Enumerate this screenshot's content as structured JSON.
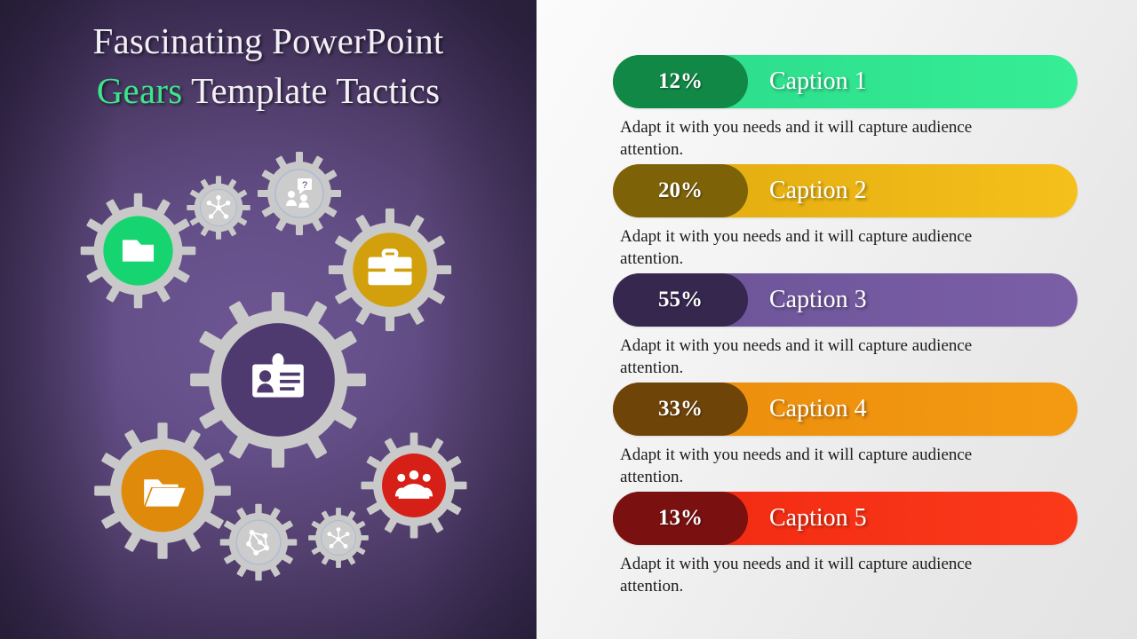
{
  "slide": {
    "title_line1": "Fascinating PowerPoint",
    "title_accent": "Gears",
    "title_line2_rest": " Template Tactics",
    "left_bg_dark": "#2e2442",
    "left_bg_light": "#6d5693",
    "right_bg": "#f2f2f2"
  },
  "gears": [
    {
      "name": "gear-folder-green",
      "icon": "folder-icon",
      "fill": "#16d46f"
    },
    {
      "name": "gear-hub-small",
      "icon": "network-hub-icon",
      "fill": "rgba(255,255,255,0.10)"
    },
    {
      "name": "gear-question-small",
      "icon": "question-people-icon",
      "fill": "rgba(255,255,255,0.10)"
    },
    {
      "name": "gear-briefcase-gold",
      "icon": "briefcase-icon",
      "fill": "#d2a00c"
    },
    {
      "name": "gear-idcard-center",
      "icon": "id-card-icon",
      "fill": "#4e3a6e"
    },
    {
      "name": "gear-openfolder-orange",
      "icon": "open-folder-icon",
      "fill": "#e08a0b"
    },
    {
      "name": "gear-users-red",
      "icon": "users-group-icon",
      "fill": "#d62017"
    },
    {
      "name": "gear-molecule-small",
      "icon": "molecule-icon",
      "fill": "rgba(255,255,255,0.10)"
    },
    {
      "name": "gear-node-small",
      "icon": "node-link-icon",
      "fill": "rgba(255,255,255,0.10)"
    }
  ],
  "bars": [
    {
      "percent": "12%",
      "caption": "Caption 1",
      "description": "Adapt it with you needs and it will capture audience attention.",
      "pill_color": "#118845",
      "bar_color_start": "#2bd98a",
      "bar_color_end": "#36ee95"
    },
    {
      "percent": "20%",
      "caption": "Caption 2",
      "description": "Adapt it with you needs and it will capture audience attention.",
      "pill_color": "#7d6208",
      "bar_color_start": "#e0a90e",
      "bar_color_end": "#f5c01b"
    },
    {
      "percent": "55%",
      "caption": "Caption 3",
      "description": "Adapt it with you needs and it will capture audience attention.",
      "pill_color": "#36274f",
      "bar_color_start": "#6b5296",
      "bar_color_end": "#7a5fa6"
    },
    {
      "percent": "33%",
      "caption": "Caption 4",
      "description": "Adapt it with you needs and it will capture audience attention.",
      "pill_color": "#6f4409",
      "bar_color_start": "#ea8c0c",
      "bar_color_end": "#f49a12"
    },
    {
      "percent": "13%",
      "caption": "Caption 5",
      "description": "Adapt it with you needs and it will capture audience attention.",
      "pill_color": "#7a1010",
      "bar_color_start": "#f02811",
      "bar_color_end": "#fb3a1a"
    }
  ],
  "chart_data": {
    "type": "bar",
    "title": "Fascinating PowerPoint Gears Template Tactics",
    "categories": [
      "Caption 1",
      "Caption 2",
      "Caption 3",
      "Caption 4",
      "Caption 5"
    ],
    "values": [
      12,
      20,
      55,
      33,
      13
    ],
    "value_labels": [
      "12%",
      "20%",
      "55%",
      "33%",
      "13%"
    ],
    "unit": "%",
    "xlabel": "",
    "ylabel": "",
    "ylim": [
      0,
      100
    ],
    "grid": false,
    "legend": "none",
    "orientation": "horizontal",
    "series_colors": [
      "#36ee95",
      "#f5c01b",
      "#7a5fa6",
      "#f49a12",
      "#fb3a1a"
    ]
  }
}
